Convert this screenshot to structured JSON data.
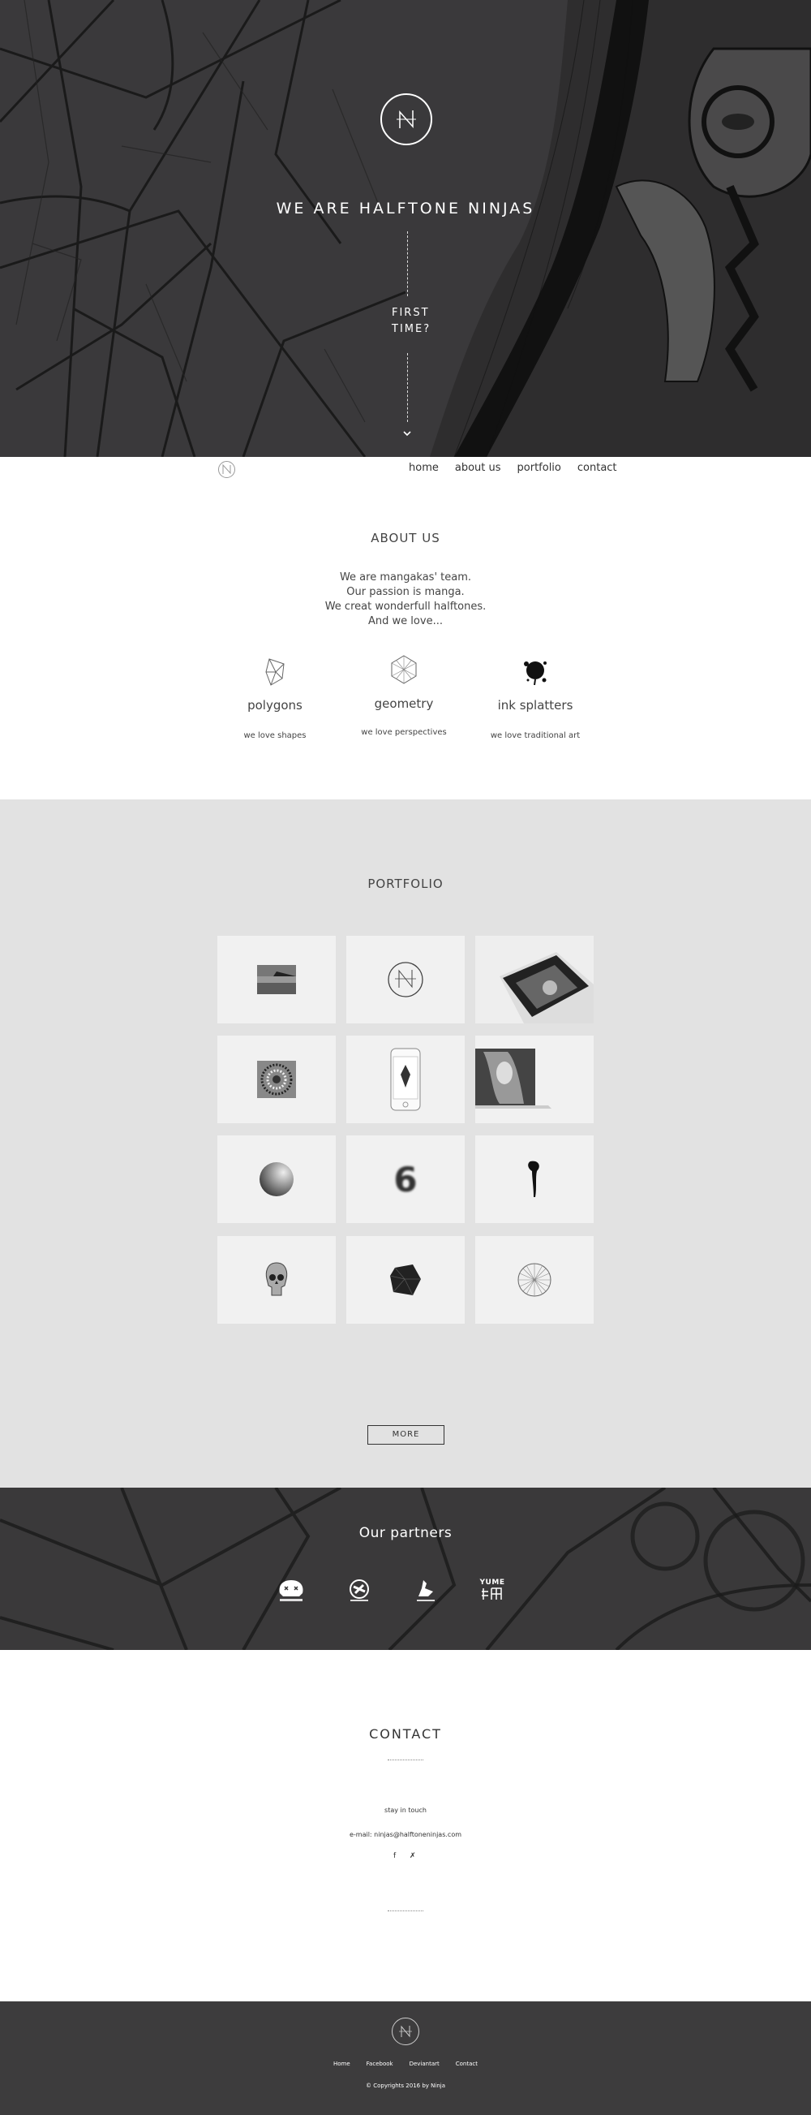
{
  "hero": {
    "title": "WE ARE HALFTONE NINJAS",
    "first_time_line1": "FIRST",
    "first_time_line2": "TIME?",
    "scroll_icon": "chevron-down-icon"
  },
  "nav": {
    "items": [
      "home",
      "about us",
      "portfolio",
      "contact"
    ]
  },
  "about": {
    "title": "ABOUT US",
    "lines": [
      "We are mangakas' team.",
      "Our passion is manga.",
      "We creat wonderfull halftones.",
      "And we love..."
    ],
    "features": [
      {
        "name": "polygons",
        "desc": "we love shapes",
        "icon": "polygon-icon"
      },
      {
        "name": "geometry",
        "desc": "we love perspectives",
        "icon": "geometry-icon"
      },
      {
        "name": "ink splatters",
        "desc": "we love traditional art",
        "icon": "ink-splatter-icon"
      }
    ]
  },
  "portfolio": {
    "title": "PORTFOLIO",
    "more_label": "MORE"
  },
  "partners": {
    "title": "Our partners",
    "items": [
      {
        "label": "",
        "icon": "skull-partner-icon"
      },
      {
        "label": "",
        "icon": "ninja-partner-icon"
      },
      {
        "label": "",
        "icon": "bird-partner-icon"
      },
      {
        "label": "YUME",
        "icon": "yume-partner-icon"
      }
    ]
  },
  "contact": {
    "title": "CONTACT",
    "stay": "stay in touch",
    "email": "e-mail:  ninjas@halftoneninjas.com",
    "social": [
      "f",
      "✗"
    ]
  },
  "footer": {
    "links": [
      "Home",
      "Facebook",
      "Deviantart",
      "Contact"
    ],
    "copyright": "© Copyrights 2016 by Ninja"
  }
}
